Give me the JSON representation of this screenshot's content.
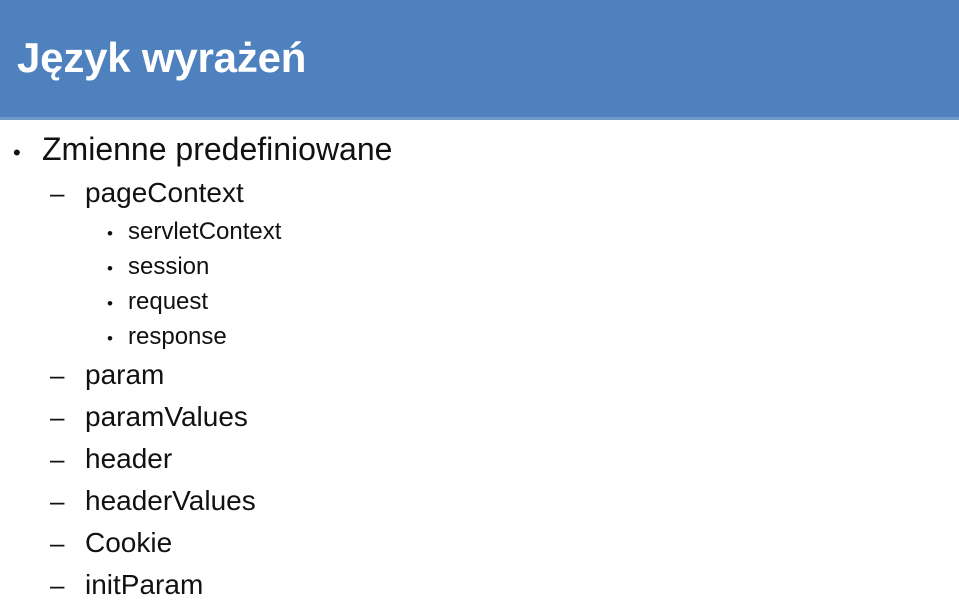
{
  "slide": {
    "title": "Język wyrażeń",
    "banner_color": "#4e81be",
    "banner_underline_color": "#6f98cb",
    "background_color": "#ffffff",
    "text_color": "#111111",
    "title_color": "#ffffff"
  },
  "outline": [
    {
      "level": 1,
      "marker": "•",
      "text": "Zmienne predefiniowane"
    },
    {
      "level": 2,
      "marker": "–",
      "text": "pageContext"
    },
    {
      "level": 3,
      "marker": "•",
      "text": "servletContext"
    },
    {
      "level": 3,
      "marker": "•",
      "text": "session"
    },
    {
      "level": 3,
      "marker": "•",
      "text": "request"
    },
    {
      "level": 3,
      "marker": "•",
      "text": "response"
    },
    {
      "level": 2,
      "marker": "–",
      "text": "param"
    },
    {
      "level": 2,
      "marker": "–",
      "text": "paramValues"
    },
    {
      "level": 2,
      "marker": "–",
      "text": "header"
    },
    {
      "level": 2,
      "marker": "–",
      "text": "headerValues"
    },
    {
      "level": 2,
      "marker": "–",
      "text": "Cookie"
    },
    {
      "level": 2,
      "marker": "–",
      "text": "initParam"
    }
  ]
}
